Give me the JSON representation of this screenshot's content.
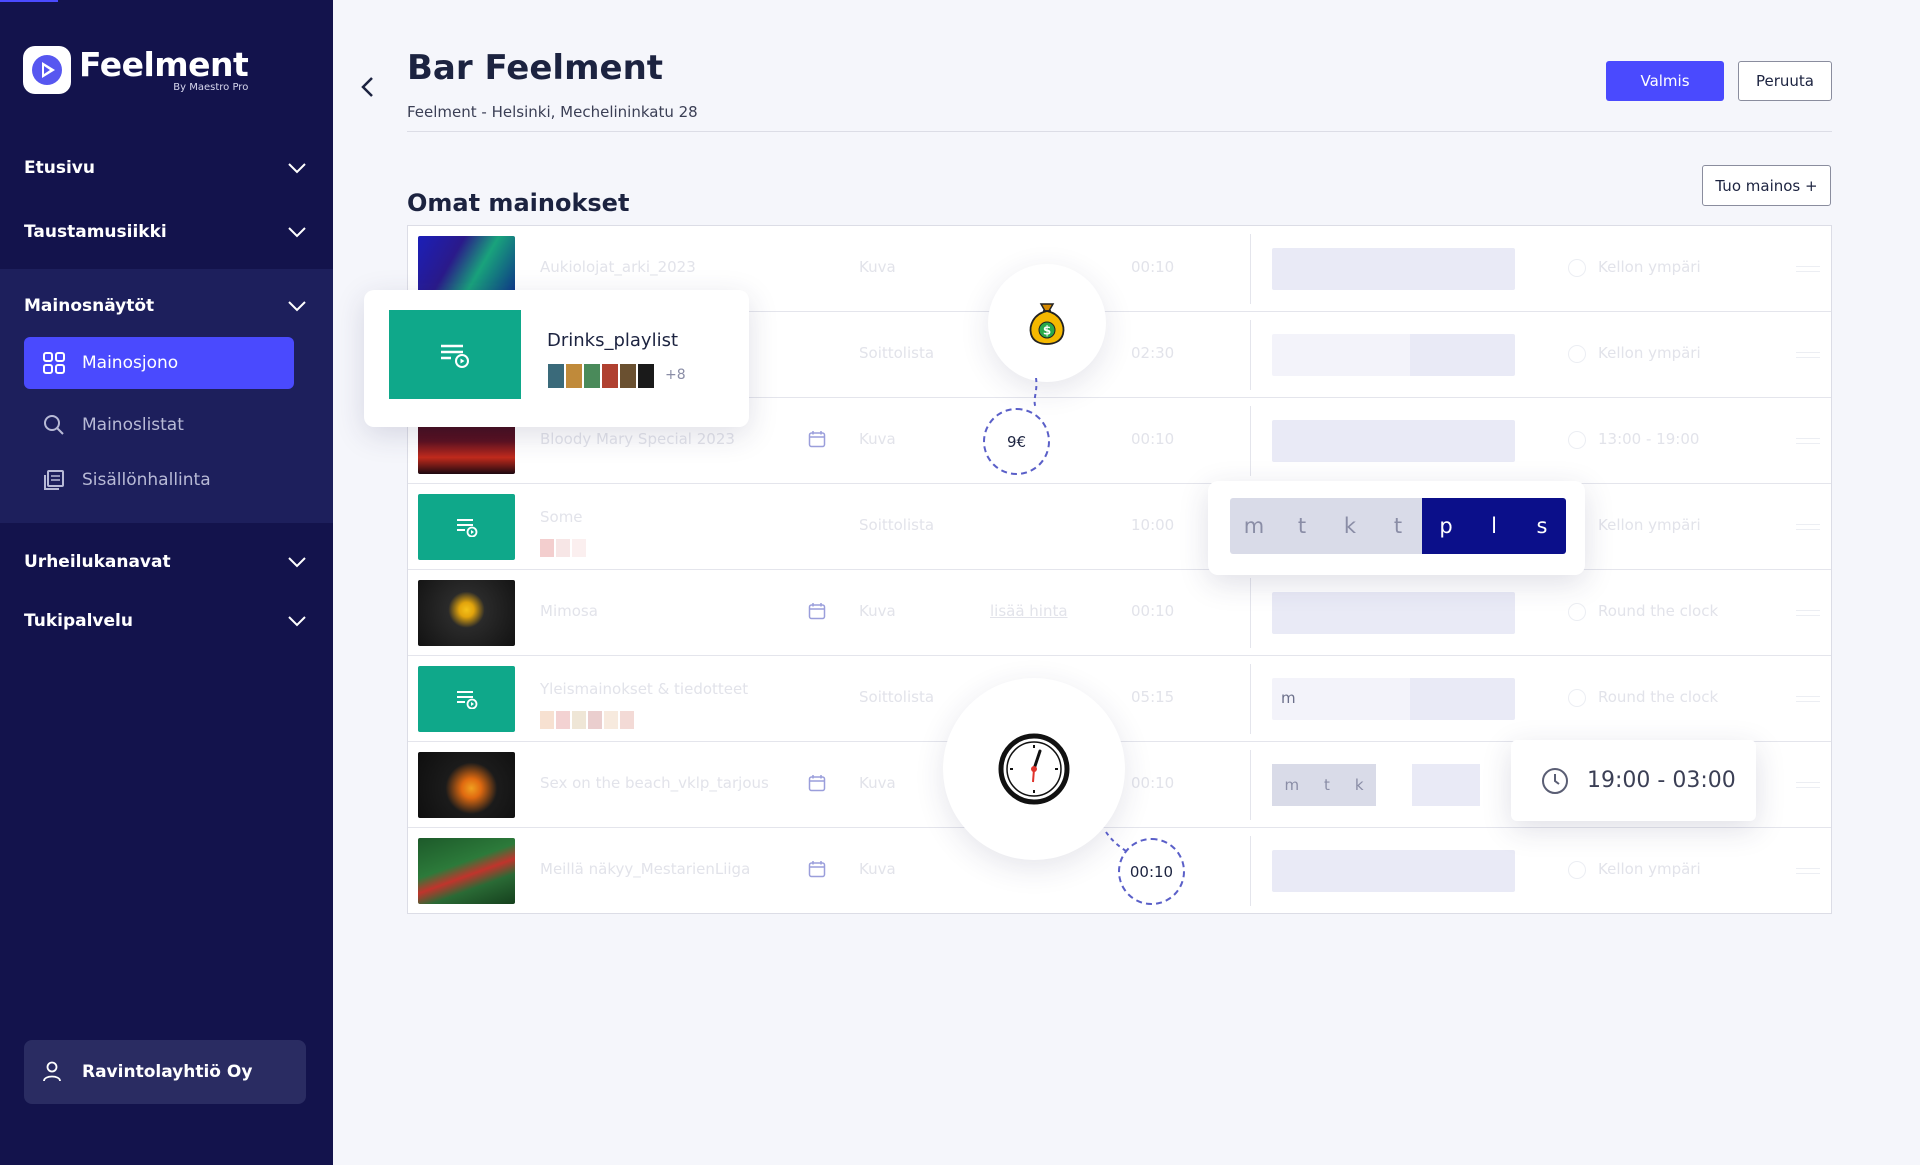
{
  "brand": {
    "name": "Feelment",
    "sub": "By Maestro Pro"
  },
  "sidebar": {
    "items": [
      {
        "label": "Etusivu"
      },
      {
        "label": "Taustamusiikki"
      },
      {
        "label": "Mainosnäytöt"
      },
      {
        "label": "Urheilukanavat"
      },
      {
        "label": "Tukipalvelu"
      }
    ],
    "subitems": [
      {
        "label": "Mainosjono",
        "icon": "grid-icon"
      },
      {
        "label": "Mainoslistat",
        "icon": "search-icon"
      },
      {
        "label": "Sisällönhallinta",
        "icon": "content-icon"
      }
    ],
    "user": "Ravintolayhtiö Oy"
  },
  "header": {
    "title": "Bar Feelment",
    "subtitle": "Feelment - Helsinki, Mechelininkatu 28",
    "done": "Valmis",
    "cancel": "Peruuta"
  },
  "section": {
    "title": "Omat mainokset",
    "import": "Tuo mainos +"
  },
  "rows": [
    {
      "name": "Aukiolojat_arki_2023",
      "type": "Kuva",
      "duration": "00:10",
      "schedule": "Kellon ympäri"
    },
    {
      "name": "",
      "type": "Soittolista",
      "duration": "02:30",
      "schedule": "Kellon ympäri"
    },
    {
      "name": "Bloody Mary Special 2023",
      "type": "Kuva",
      "duration": "00:10",
      "schedule": "13:00 - 19:00"
    },
    {
      "name": "Some",
      "type": "Soittolista",
      "duration": "10:00",
      "schedule": "Kellon ympäri"
    },
    {
      "name": "Mimosa",
      "type": "Kuva",
      "price": "lisää hinta",
      "duration": "00:10",
      "schedule": "Round the clock"
    },
    {
      "name": "Yleismainokset & tiedotteet",
      "type": "Soittolista",
      "duration": "05:15",
      "days": "m",
      "schedule": "Round the clock"
    },
    {
      "name": "Sex on the beach_vklp_tarjous",
      "type": "Kuva",
      "duration": "00:10",
      "days": [
        "m",
        "t",
        "k"
      ],
      "schedule": ""
    },
    {
      "name": "Meillä näkyy_MestarienLiiga",
      "type": "Kuva",
      "duration": "00:10",
      "schedule": "Kellon ympäri"
    }
  ],
  "overlays": {
    "playlist": {
      "name": "Drinks_playlist",
      "more": "+8"
    },
    "price": "9€",
    "duration": "00:10",
    "days": [
      "m",
      "t",
      "k",
      "t",
      "p",
      "l",
      "s"
    ],
    "time": "19:00 - 03:00",
    "colors": {
      "accent": "#4a4afe",
      "sidebar": "#13134c",
      "teal": "#0fa88a",
      "dayOn": "#0b0f8a"
    }
  }
}
